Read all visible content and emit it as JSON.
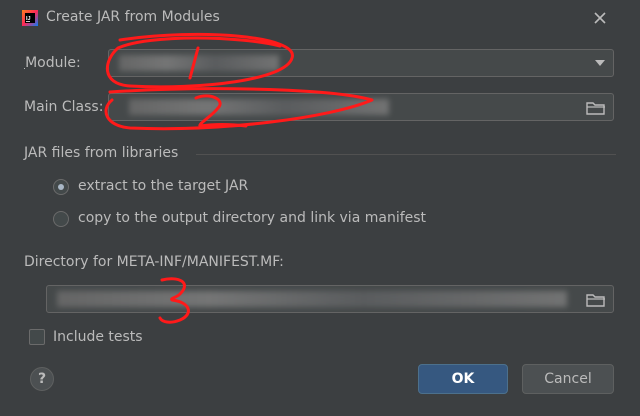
{
  "window": {
    "title": "Create JAR from Modules",
    "app_icon_text": "IJ"
  },
  "form": {
    "module_label": "Module:",
    "main_class_label": "Main Class:",
    "jar_section_label": "JAR files from libraries",
    "radio_extract_label": "extract to the target JAR",
    "radio_copy_label": "copy to the output directory and link via manifest",
    "manifest_dir_label": "Directory for META-INF/MANIFEST.MF:",
    "include_tests_label": "Include tests",
    "selected_option": "extract to the target JAR",
    "include_tests_checked": false
  },
  "buttons": {
    "help": "?",
    "ok": "OK",
    "cancel": "Cancel"
  },
  "annotations": [
    "1",
    "2",
    "3"
  ],
  "colors": {
    "background": "#3c3f41",
    "field": "#45494a",
    "ok_button": "#365880",
    "annotation": "#ff0000"
  },
  "icons": [
    "app-icon",
    "close-icon",
    "dropdown-arrow-icon",
    "folder-icon"
  ]
}
